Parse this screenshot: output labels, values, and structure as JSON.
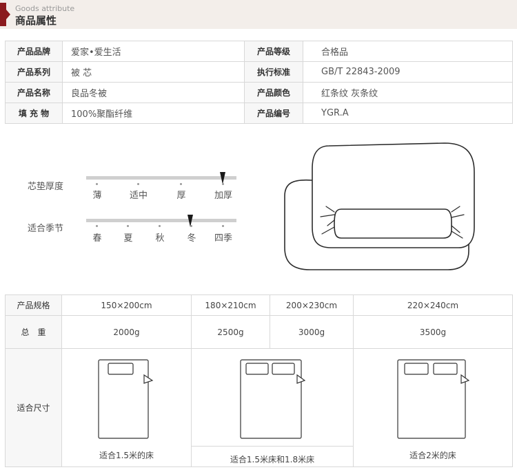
{
  "header": {
    "english": "Goods attribute",
    "chinese": "商品属性"
  },
  "attributes": [
    {
      "l1": "产品品牌",
      "v1": "爱家•爱生活",
      "l2": "产品等级",
      "v2": "合格品"
    },
    {
      "l1": "产品系列",
      "v1": "被 芯",
      "l2": "执行标准",
      "v2": "GB/T 22843-2009"
    },
    {
      "l1": "产品名称",
      "v1": "良品冬被",
      "l2": "产品颜色",
      "v2": "红条纹 灰条纹"
    },
    {
      "l1": "填 充 物",
      "v1": "100%聚酯纤维",
      "l2": "产品编号",
      "v2": "YGR.A"
    }
  ],
  "thickness": {
    "title": "芯垫厚度",
    "ticks": [
      "薄",
      "适中",
      "厚",
      "加厚"
    ],
    "selected": "加厚"
  },
  "season": {
    "title": "适合季节",
    "ticks": [
      "春",
      "夏",
      "秋",
      "冬",
      "四季"
    ],
    "selected": "冬"
  },
  "spec": {
    "size_label": "产品规格",
    "weight_label": "总　重",
    "fit_label": "适合尺寸",
    "sizes": [
      "150×200cm",
      "180×210cm",
      "200×230cm",
      "220×240cm"
    ],
    "weights": [
      "2000g",
      "2500g",
      "3000g",
      "3500g"
    ],
    "fits": [
      "适合1.5米的床",
      "适合1.5米床和1.8米床",
      "适合2米的床"
    ]
  },
  "colors": {
    "accent": "#8b1a1e",
    "header_bg": "#f3eeea",
    "border": "#d8d8d8"
  }
}
